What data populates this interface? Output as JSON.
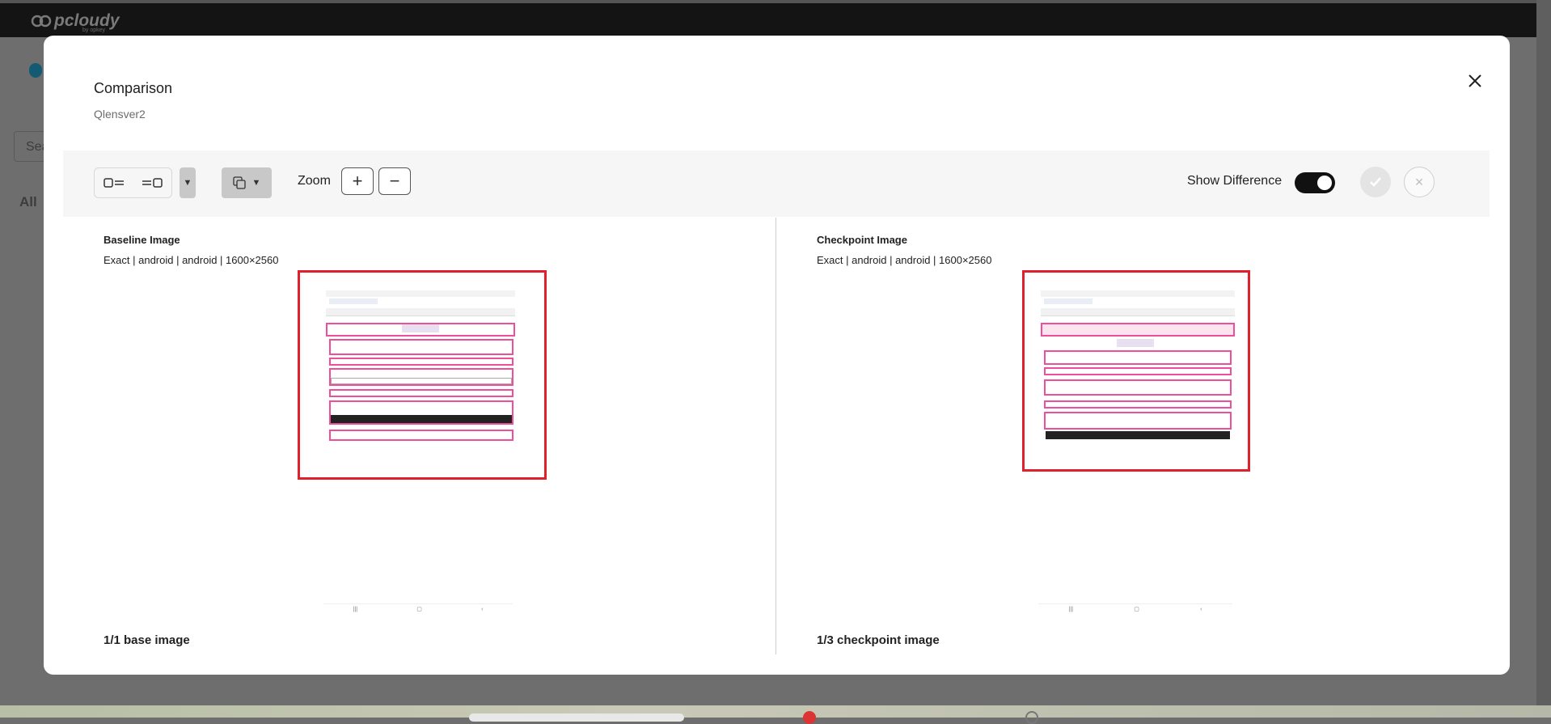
{
  "app": {
    "logo_text": "pcloudy",
    "logo_sub": "by opkey",
    "search_placeholder": "Sea",
    "all_label": "All"
  },
  "modal": {
    "title": "Comparison",
    "subtitle": "Qlensver2"
  },
  "toolbar": {
    "zoom_label": "Zoom",
    "zoom_in": "+",
    "zoom_out": "−",
    "show_difference_label": "Show Difference",
    "show_difference_on": true,
    "reject_label": "×"
  },
  "baseline": {
    "title": "Baseline Image",
    "meta": "Exact | android | android | 1600×2560",
    "count": "1/1 base image"
  },
  "checkpoint": {
    "title": "Checkpoint Image",
    "meta": "Exact | android | android | 1600×2560",
    "count": "1/3 checkpoint image"
  },
  "colors": {
    "highlight": "#e0202a",
    "diff_box": "#ee4f9a",
    "toggle_on": "#111111"
  }
}
